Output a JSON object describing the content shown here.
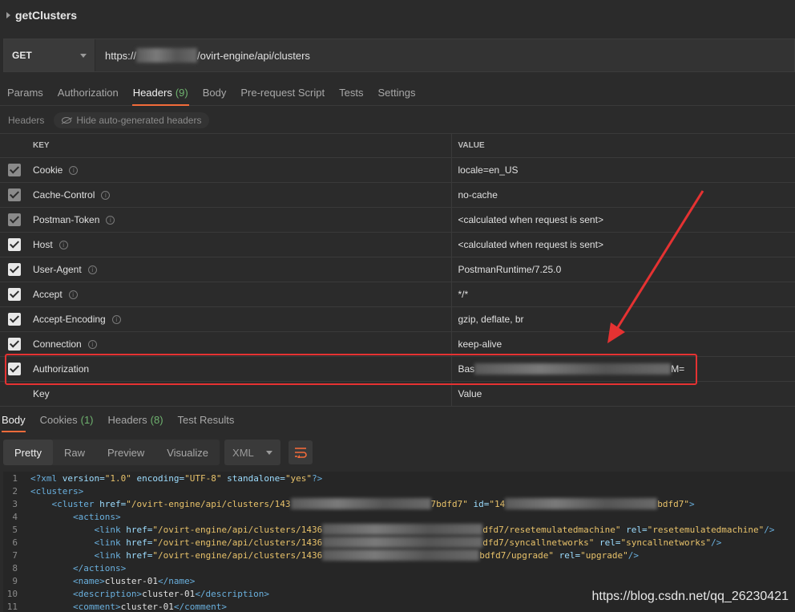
{
  "request": {
    "name": "getClusters",
    "method": "GET",
    "url_prefix": "https://",
    "url_suffix": "/ovirt-engine/api/clusters"
  },
  "request_tabs": [
    {
      "label": "Params",
      "count": ""
    },
    {
      "label": "Authorization",
      "count": ""
    },
    {
      "label": "Headers",
      "count": "(9)"
    },
    {
      "label": "Body",
      "count": ""
    },
    {
      "label": "Pre-request Script",
      "count": ""
    },
    {
      "label": "Tests",
      "count": ""
    },
    {
      "label": "Settings",
      "count": ""
    }
  ],
  "headers_bar": {
    "label": "Headers",
    "toggle": "Hide auto-generated headers"
  },
  "columns": {
    "key": "KEY",
    "value": "VALUE"
  },
  "header_rows": [
    {
      "key": "Cookie",
      "value": "locale=en_US"
    },
    {
      "key": "Cache-Control",
      "value": "no-cache"
    },
    {
      "key": "Postman-Token",
      "value": "<calculated when request is sent>"
    },
    {
      "key": "Host",
      "value": "<calculated when request is sent>"
    },
    {
      "key": "User-Agent",
      "value": "PostmanRuntime/7.25.0"
    },
    {
      "key": "Accept",
      "value": "*/*"
    },
    {
      "key": "Accept-Encoding",
      "value": "gzip, deflate, br"
    },
    {
      "key": "Connection",
      "value": "keep-alive"
    },
    {
      "key": "Authorization",
      "value_prefix": "Bas",
      "value_suffix": "M="
    }
  ],
  "new_row": {
    "key_placeholder": "Key",
    "value_placeholder": "Value"
  },
  "response_tabs": [
    {
      "label": "Body",
      "count": ""
    },
    {
      "label": "Cookies",
      "count": "(1)"
    },
    {
      "label": "Headers",
      "count": "(8)"
    },
    {
      "label": "Test Results",
      "count": ""
    }
  ],
  "view_modes": [
    "Pretty",
    "Raw",
    "Preview",
    "Visualize"
  ],
  "format": "XML",
  "code_lines": {
    "l1": "1",
    "l2": "2",
    "l3": "3",
    "l4": "4",
    "l5": "5",
    "l6": "6",
    "l7": "7",
    "l8": "8",
    "l9": "9",
    "l10": "10",
    "l11": "11",
    "cluster_href": "\"/ovirt-engine/api/clusters/143",
    "cluster_id_pre": "\"14",
    "cluster_id_suf": "bdfd7\"",
    "cluster_href_suf": "7bdfd7\"",
    "link_href": "\"/ovirt-engine/api/clusters/1436",
    "link1_suf": "dfd7/resetemulatedmachine\"",
    "link2_suf": "dfd7/syncallnetworks\"",
    "link3_suf": "bdfd7/upgrade\"",
    "rel1": "\"resetemulatedmachine\"",
    "rel2": "\"syncallnetworks\"",
    "rel3": "\"upgrade\"",
    "name": "cluster-01",
    "description": "cluster-01",
    "comment": "cluster-01"
  },
  "watermark": "https://blog.csdn.net/qq_26230421"
}
